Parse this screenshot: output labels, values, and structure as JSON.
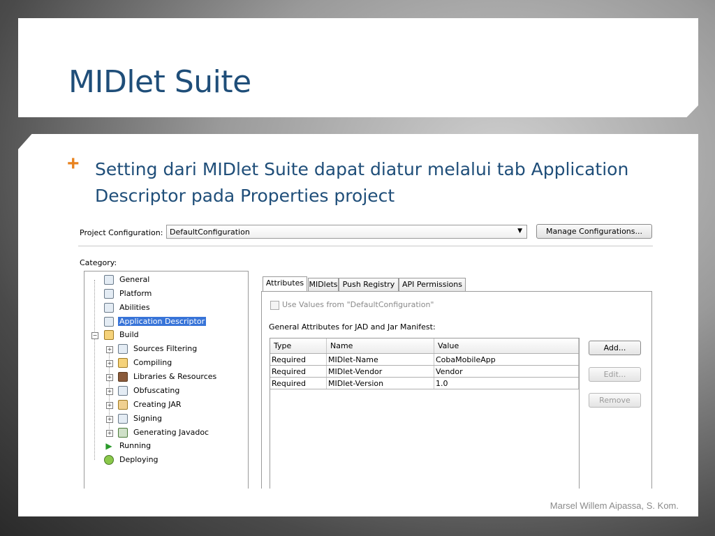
{
  "slide": {
    "title": "MIDlet Suite",
    "bullet": "Setting dari MIDlet Suite dapat diatur melalui tab Application Descriptor pada Properties project",
    "footer": "Marsel Willem Aipassa, S. Kom."
  },
  "dialog": {
    "config_label": "Project Configuration:",
    "config_value": "DefaultConfiguration",
    "manage_button": "Manage Configurations...",
    "category_label": "Category:",
    "tree": [
      {
        "label": "General",
        "icon": "general-icon"
      },
      {
        "label": "Platform",
        "icon": "platform-icon"
      },
      {
        "label": "Abilities",
        "icon": "abilities-icon"
      },
      {
        "label": "Application Descriptor",
        "icon": "descriptor-icon",
        "selected": true
      },
      {
        "label": "Build",
        "icon": "build-icon"
      },
      {
        "label": "Sources Filtering",
        "icon": "filter-icon"
      },
      {
        "label": "Compiling",
        "icon": "compiling-icon"
      },
      {
        "label": "Libraries & Resources",
        "icon": "libraries-icon"
      },
      {
        "label": "Obfuscating",
        "icon": "obfuscating-icon"
      },
      {
        "label": "Creating JAR",
        "icon": "jar-icon"
      },
      {
        "label": "Signing",
        "icon": "signing-icon"
      },
      {
        "label": "Generating Javadoc",
        "icon": "javadoc-icon"
      },
      {
        "label": "Running",
        "icon": "run-icon"
      },
      {
        "label": "Deploying",
        "icon": "deploy-icon"
      }
    ],
    "tabs": [
      "Attributes",
      "MIDlets",
      "Push Registry",
      "API Permissions"
    ],
    "use_values_label": "Use Values from \"DefaultConfiguration\"",
    "general_label": "General Attributes for JAD and Jar Manifest:",
    "table": {
      "headers": [
        "Type",
        "Name",
        "Value"
      ],
      "rows": [
        [
          "Required",
          "MIDlet-Name",
          "CobaMobileApp"
        ],
        [
          "Required",
          "MIDlet-Vendor",
          "Vendor"
        ],
        [
          "Required",
          "MIDlet-Version",
          "1.0"
        ]
      ]
    },
    "buttons": {
      "add": "Add...",
      "edit": "Edit...",
      "remove": "Remove"
    }
  },
  "colors": {
    "title": "#1f4e79",
    "bullet": "#e8821e",
    "selection": "#3874d8"
  }
}
